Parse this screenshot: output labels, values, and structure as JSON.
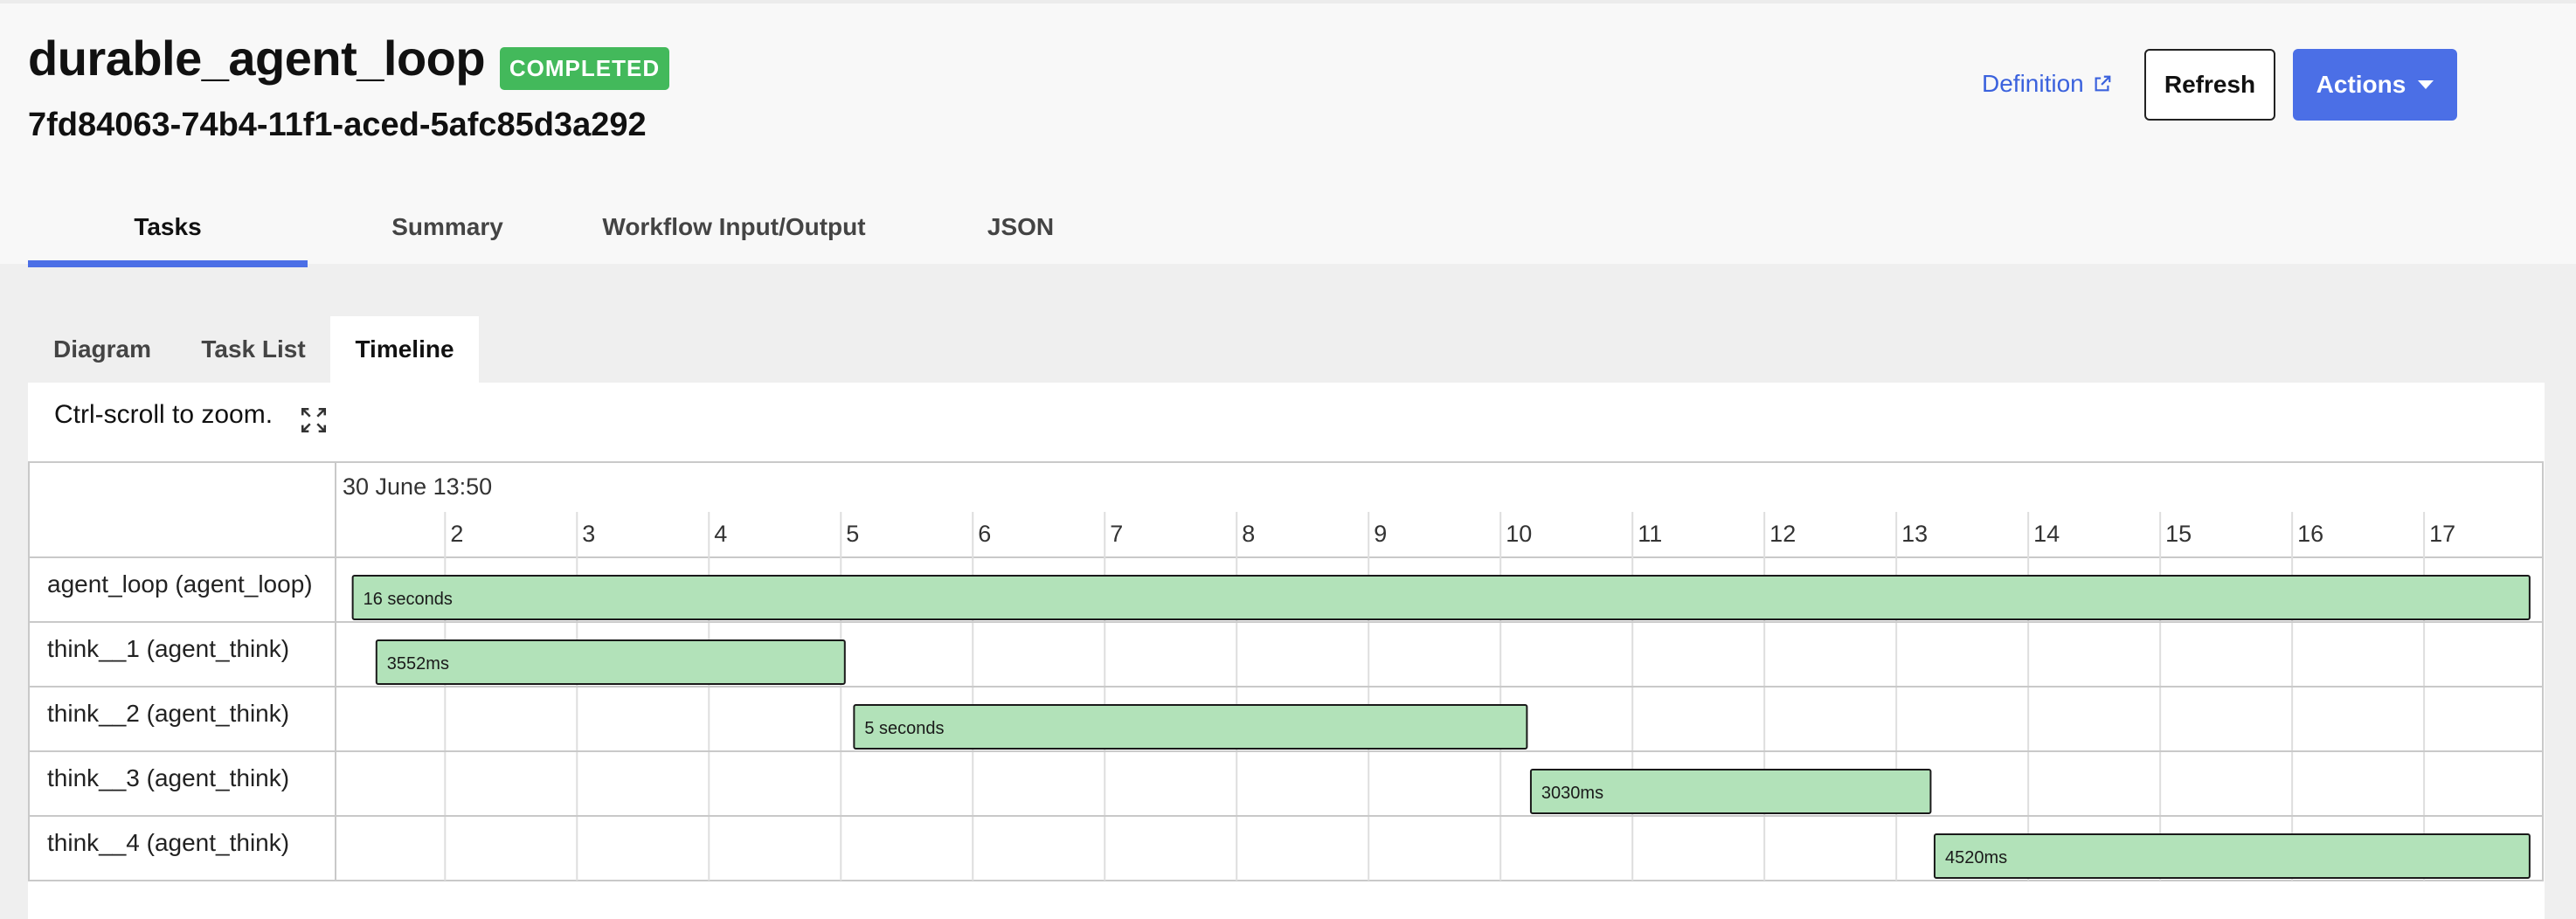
{
  "header": {
    "title": "durable_agent_loop",
    "status": "COMPLETED",
    "workflow_id": "7fd84063-74b4-11f1-aced-5afc85d3a292",
    "definition_label": "Definition",
    "refresh_label": "Refresh",
    "actions_label": "Actions"
  },
  "tabs": [
    {
      "label": "Tasks",
      "active": true
    },
    {
      "label": "Summary",
      "active": false
    },
    {
      "label": "Workflow Input/Output",
      "active": false
    },
    {
      "label": "JSON",
      "active": false
    }
  ],
  "subtabs": [
    {
      "label": "Diagram",
      "active": false
    },
    {
      "label": "Task List",
      "active": false
    },
    {
      "label": "Timeline",
      "active": true
    }
  ],
  "timeline": {
    "hint": "Ctrl-scroll to zoom.",
    "date_label": "30 June 13:50"
  },
  "colors": {
    "accent": "#4b6fe6",
    "status_green": "#43b95b",
    "bar_fill": "#b2e2b9",
    "link": "#3b62dd"
  },
  "chart_data": {
    "type": "gantt",
    "x_unit": "seconds",
    "x_axis_label": "30 June 13:50",
    "x_ticks": [
      2,
      3,
      4,
      5,
      6,
      7,
      8,
      9,
      10,
      11,
      12,
      13,
      14,
      15,
      16,
      17
    ],
    "xlim": [
      1.17,
      17.9
    ],
    "tasks": [
      {
        "name": "agent_loop (agent_loop)",
        "start": 1.3,
        "end": 17.8,
        "label": "16 seconds"
      },
      {
        "name": "think__1 (agent_think)",
        "start": 1.48,
        "end": 5.03,
        "label": "3552ms"
      },
      {
        "name": "think__2 (agent_think)",
        "start": 5.1,
        "end": 10.2,
        "label": "5 seconds"
      },
      {
        "name": "think__3 (agent_think)",
        "start": 10.23,
        "end": 13.26,
        "label": "3030ms"
      },
      {
        "name": "think__4 (agent_think)",
        "start": 13.29,
        "end": 17.8,
        "label": "4520ms"
      }
    ]
  }
}
